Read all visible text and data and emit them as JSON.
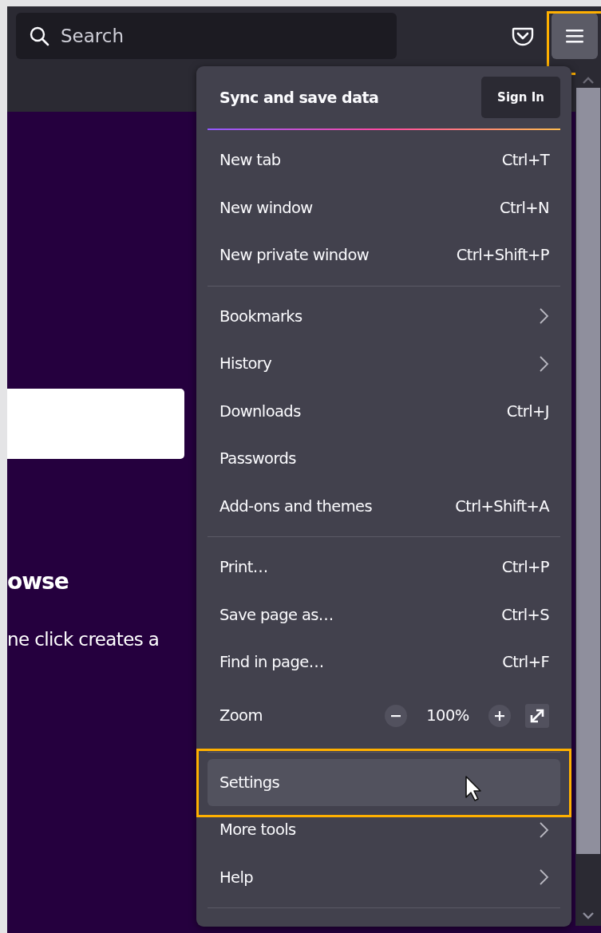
{
  "toolbar": {
    "search": {
      "placeholder": "Search"
    },
    "menu_button": {
      "highlighted": true
    }
  },
  "page": {
    "heading": "owse",
    "text": "ne click creates a"
  },
  "menu": {
    "header": {
      "title": "Sync and save data",
      "button": "Sign In"
    },
    "sections": [
      [
        {
          "kind": "item",
          "label": "New tab",
          "shortcut": "Ctrl+T",
          "hovered": false,
          "highlighted": false
        },
        {
          "kind": "item",
          "label": "New window",
          "shortcut": "Ctrl+N",
          "hovered": false,
          "highlighted": false
        },
        {
          "kind": "item",
          "label": "New private window",
          "shortcut": "Ctrl+Shift+P",
          "hovered": false,
          "highlighted": false
        }
      ],
      [
        {
          "kind": "submenu",
          "label": "Bookmarks",
          "hovered": false,
          "highlighted": false
        },
        {
          "kind": "submenu",
          "label": "History",
          "hovered": false,
          "highlighted": false
        },
        {
          "kind": "item",
          "label": "Downloads",
          "shortcut": "Ctrl+J",
          "hovered": false,
          "highlighted": false
        },
        {
          "kind": "item",
          "label": "Passwords",
          "hovered": false,
          "highlighted": false
        },
        {
          "kind": "item",
          "label": "Add-ons and themes",
          "shortcut": "Ctrl+Shift+A",
          "hovered": false,
          "highlighted": false
        }
      ],
      [
        {
          "kind": "item",
          "label": "Print…",
          "shortcut": "Ctrl+P",
          "hovered": false,
          "highlighted": false
        },
        {
          "kind": "item",
          "label": "Save page as…",
          "shortcut": "Ctrl+S",
          "hovered": false,
          "highlighted": false
        },
        {
          "kind": "item",
          "label": "Find in page…",
          "shortcut": "Ctrl+F",
          "hovered": false,
          "highlighted": false
        },
        {
          "kind": "zoom",
          "label": "Zoom",
          "value": "100%",
          "hovered": false,
          "highlighted": false
        }
      ],
      [
        {
          "kind": "item",
          "label": "Settings",
          "hovered": true,
          "highlighted": true
        },
        {
          "kind": "submenu",
          "label": "More tools",
          "hovered": false,
          "highlighted": false
        },
        {
          "kind": "submenu",
          "label": "Help",
          "hovered": false,
          "highlighted": false
        }
      ]
    ]
  }
}
